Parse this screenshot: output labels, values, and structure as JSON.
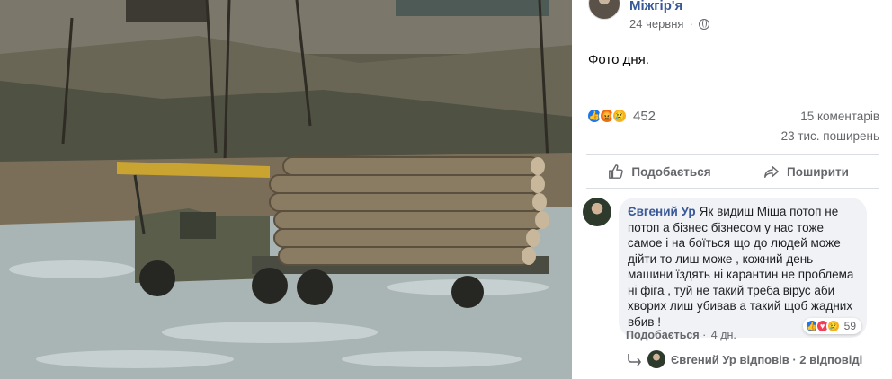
{
  "post": {
    "page_name": "Міжгір'я",
    "date": "24 червня",
    "text": "Фото дня.",
    "reaction_count": "452",
    "comments": "15 коментарів",
    "shares": "23 тис. поширень",
    "reaction_icons": [
      "like-icon",
      "angry-icon",
      "sad-icon"
    ]
  },
  "actions": {
    "like_label": "Подобається",
    "share_label": "Поширити"
  },
  "comment": {
    "author": "Євгений Ур",
    "text": "Як видиш Міша потоп не потоп а бізнес бізнесом у нас тоже самое і на боїться що до людей може дійти то лиш може , кожний день машини їздять ні карантин не проблема ні фіга , туй не такий треба вірус аби хворих лиш убивав а такий щоб жадних вбив !",
    "reaction_count": "59",
    "reaction_icons": [
      "like-icon",
      "love-icon",
      "sad-icon"
    ],
    "like_link": "Подобається",
    "time": "4 дн."
  },
  "replies": {
    "text": "Євгений Ур відповів · 2 відповіді"
  },
  "colors": {
    "link": "#385898",
    "secondary_text": "#65676b",
    "bubble": "#f0f2f5",
    "like_blue": "#1877f2"
  }
}
